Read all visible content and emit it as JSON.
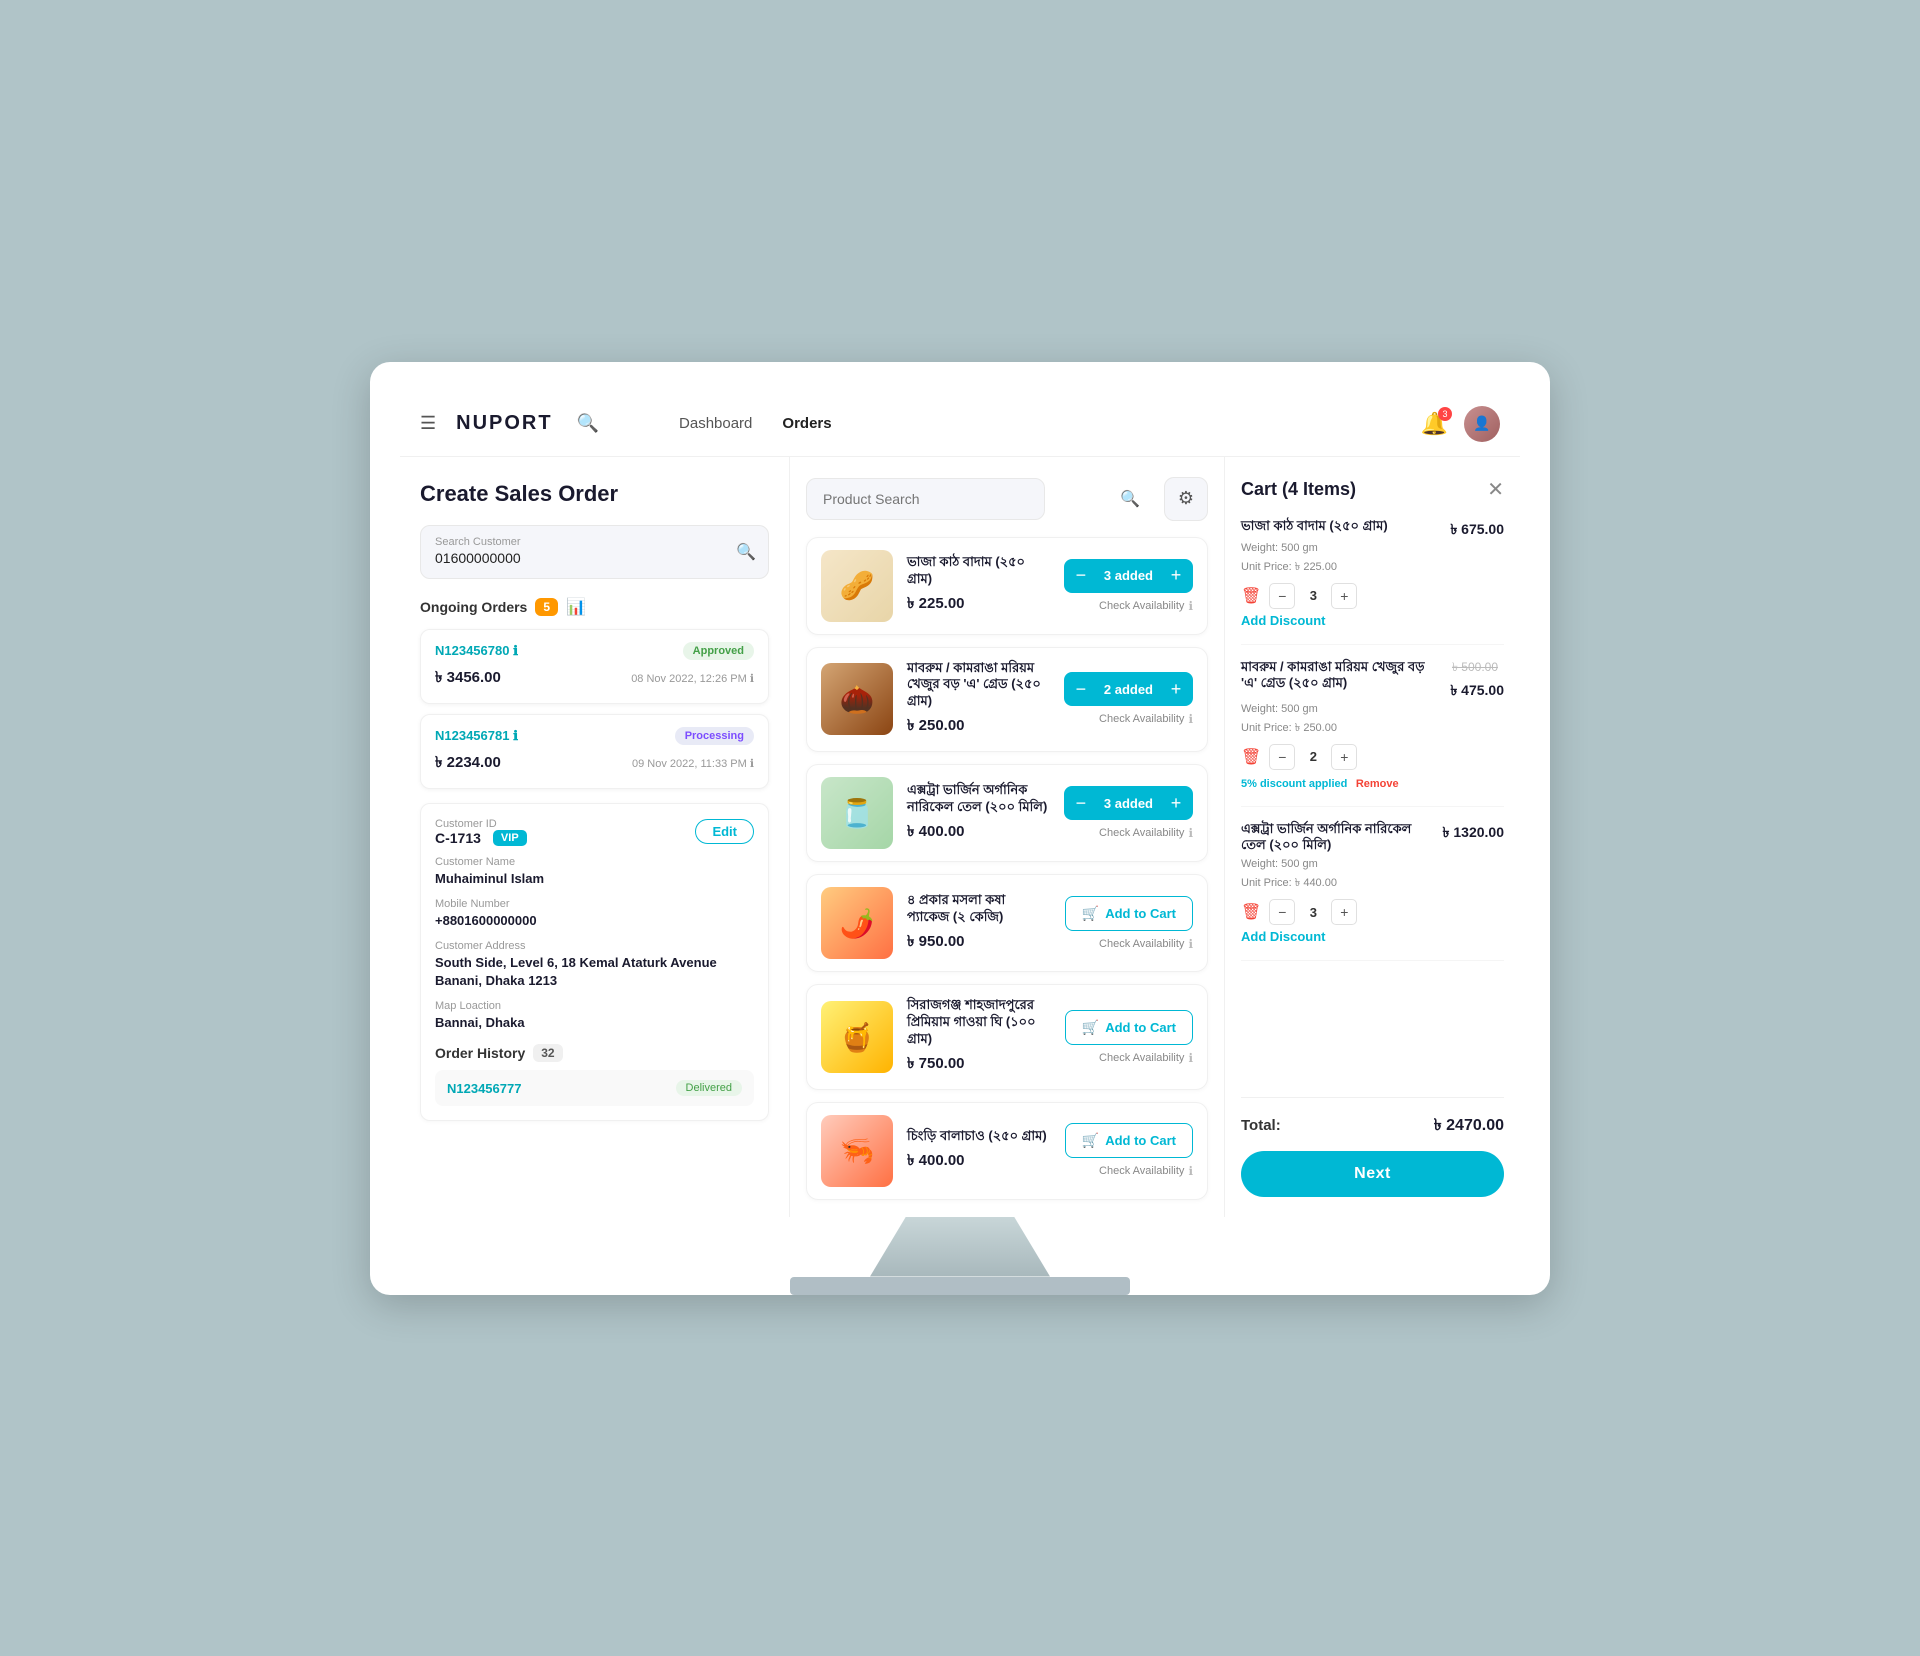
{
  "app": {
    "logo": "NUPORT",
    "nav": {
      "dashboard": "Dashboard",
      "orders": "Orders"
    },
    "bell_badge": "3",
    "page_title": "Create Sales Order"
  },
  "left_panel": {
    "search_customer": {
      "label": "Search Customer",
      "value": "01600000000",
      "placeholder": "Search Customer"
    },
    "ongoing_orders": {
      "title": "Ongoing Orders",
      "count": "5",
      "orders": [
        {
          "id": "N123456780",
          "status": "Approved",
          "status_class": "status-approved",
          "amount": "৳ 3456.00",
          "date": "08 Nov 2022, 12:26 PM"
        },
        {
          "id": "N123456781",
          "status": "Processing",
          "status_class": "status-processing",
          "amount": "৳ 2234.00",
          "date": "09 Nov 2022, 11:33 PM"
        }
      ]
    },
    "customer": {
      "id_label": "Customer ID",
      "id_value": "C-1713",
      "vip": "VIP",
      "edit_label": "Edit",
      "name_label": "Customer Name",
      "name_value": "Muhaiminul Islam",
      "mobile_label": "Mobile Number",
      "mobile_value": "+8801600000000",
      "address_label": "Customer Address",
      "address_value": "South Side, Level 6, 18 Kemal Ataturk Avenue Banani, Dhaka 1213",
      "map_label": "Map Loaction",
      "map_value": "Bannai, Dhaka",
      "order_history_label": "Order History",
      "order_history_count": "32",
      "history_orders": [
        {
          "id": "N123456777",
          "status": "Delivered",
          "status_class": "status-delivered"
        }
      ]
    }
  },
  "middle_panel": {
    "search_placeholder": "Product Search",
    "products": [
      {
        "id": "p1",
        "name": "ভাজা কাঠ বাদাম (২৫০ গ্রাম)",
        "price": "৳ 225.00",
        "img_class": "prod-img-almond",
        "img_emoji": "🥜",
        "in_cart": true,
        "qty": "3 added"
      },
      {
        "id": "p2",
        "name": "মাবরুম / কামরাঙা মরিয়ম খেজুর বড় 'এ' গ্রেড (২৫০ গ্রাম)",
        "price": "৳ 250.00",
        "img_class": "prod-img-dates",
        "img_emoji": "🌰",
        "in_cart": true,
        "qty": "2 added"
      },
      {
        "id": "p3",
        "name": "এক্সট্রা ভার্জিন অর্গানিক নারিকেল তেল (২০০ মিলি)",
        "price": "৳ 400.00",
        "img_class": "prod-img-coconut",
        "img_emoji": "🫙",
        "in_cart": true,
        "qty": "3 added"
      },
      {
        "id": "p4",
        "name": "৪ প্রকার মসলা কষা প্যাকেজ (২ কেজি)",
        "price": "৳ 950.00",
        "img_class": "prod-img-spice",
        "img_emoji": "🌶️",
        "in_cart": false,
        "add_to_cart_label": "Add to Cart"
      },
      {
        "id": "p5",
        "name": "সিরাজগঞ্জ শাহজাদপুরের প্রিমিয়াম গাওয়া ঘি (১০০ গ্রাম)",
        "price": "৳ 750.00",
        "img_class": "prod-img-honey",
        "img_emoji": "🍯",
        "in_cart": false,
        "add_to_cart_label": "Add to Cart"
      },
      {
        "id": "p6",
        "name": "চিংড়ি বালাচাও (২৫০ গ্রাম)",
        "price": "৳ 400.00",
        "img_class": "prod-img-shrimp",
        "img_emoji": "🦐",
        "in_cart": false,
        "add_to_cart_label": "Add to Cart"
      }
    ],
    "check_availability": "Check Availability"
  },
  "cart": {
    "title": "Cart (4 Items)",
    "items": [
      {
        "name": "ভাজা কাঠ বাদাম (২৫০ গ্রাম)",
        "price": "৳ 675.00",
        "weight": "Weight: 500 gm",
        "unit_price": "Unit Price: ৳ 225.00",
        "qty": "3",
        "has_discount": false,
        "add_discount_label": "Add Discount"
      },
      {
        "name": "মাবরুম / কামরাঙা মরিয়ম খেজুর বড় 'এ' গ্রেড (২৫০ গ্রাম)",
        "price": "৳ 475.00",
        "orig_price": "৳ 500.00",
        "weight": "Weight: 500 gm",
        "unit_price": "Unit Price: ৳ 250.00",
        "qty": "2",
        "has_discount": true,
        "discount_text": "5% discount applied",
        "remove_label": "Remove"
      },
      {
        "name": "এক্সট্রা ভার্জিন অর্গানিক নারিকেল তেল (২০০ মিলি)",
        "price": "৳ 1320.00",
        "weight": "Weight: 500 gm",
        "unit_price": "Unit Price: ৳ 440.00",
        "qty": "3",
        "has_discount": false,
        "add_discount_label": "Add Discount"
      }
    ],
    "total_label": "Total:",
    "total_value": "৳ 2470.00",
    "next_label": "Next"
  }
}
